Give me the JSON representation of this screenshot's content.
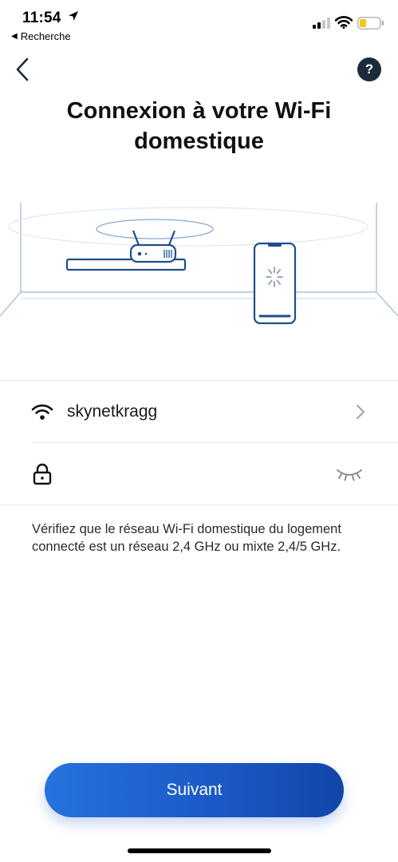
{
  "status_bar": {
    "time": "11:54",
    "back_app_label": "Recherche",
    "battery_color": "#f5c518"
  },
  "header": {
    "title": "Connexion à votre Wi-Fi domestique",
    "help_label": "?"
  },
  "network": {
    "ssid": "skynetkragg",
    "password_value": ""
  },
  "help_text": "Vérifiez que le réseau Wi-Fi domestique du logement connecté est un réseau 2,4 GHz ou mixte 2,4/5 GHz.",
  "footer": {
    "next_label": "Suivant"
  },
  "colors": {
    "accent": "#1a58c4",
    "illustration_line": "#1f4e8c",
    "help_bg": "#1c2b3c"
  }
}
